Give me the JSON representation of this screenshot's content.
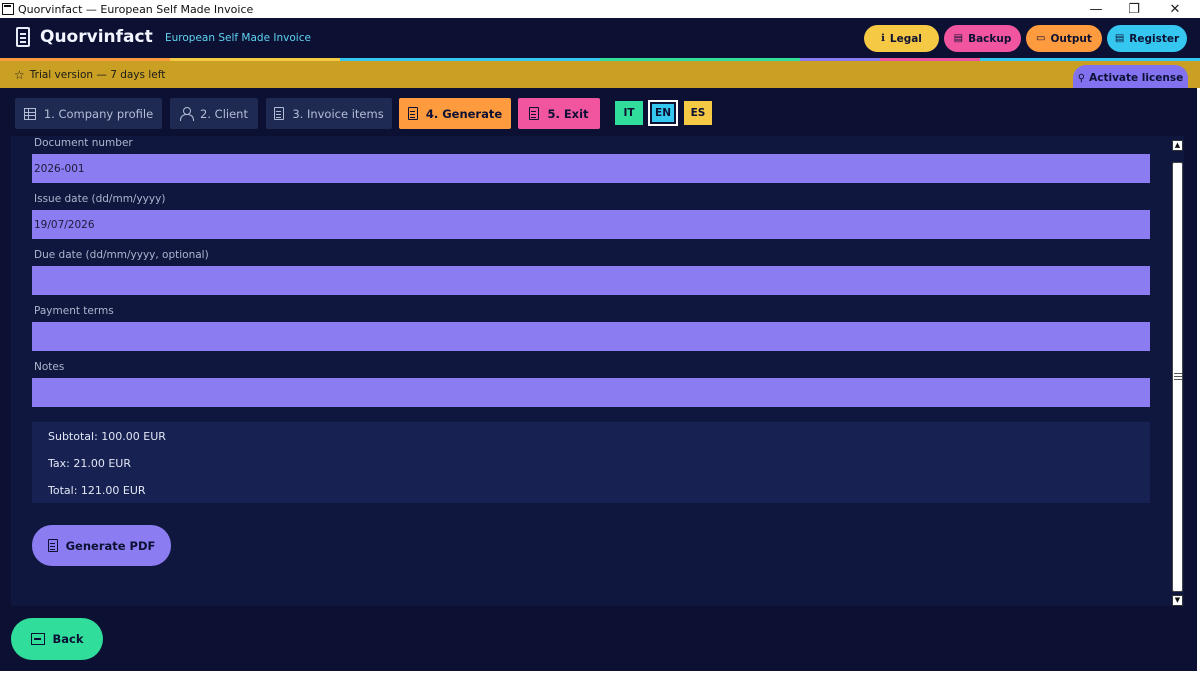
{
  "window": {
    "title": "Quorvinfact — European Self Made Invoice",
    "minimize": "—",
    "restore": "❐",
    "close": "✕"
  },
  "header": {
    "app_name": "Quorvinfact",
    "subtitle": "European Self Made Invoice",
    "buttons": {
      "legal": {
        "icon": "info-icon",
        "glyph": "ℹ",
        "label": "Legal",
        "color": "#f6c945"
      },
      "backup": {
        "icon": "save-icon",
        "glyph": "▤",
        "label": "Backup",
        "color": "#f2559f"
      },
      "output": {
        "icon": "folder-icon",
        "glyph": "▭",
        "label": "Output",
        "color": "#ff9b3f"
      },
      "register": {
        "icon": "register-icon",
        "glyph": "▤",
        "label": "Register",
        "color": "#35c7ef"
      }
    },
    "stripe_colors": [
      "#ff9b3f",
      "#f6c945",
      "#35c7ef",
      "#31dd9a",
      "#8b7cf1",
      "#f2559f",
      "#35c7ef"
    ]
  },
  "trial": {
    "text": "Trial version — 7 days left",
    "activate_label": "Activate license"
  },
  "tabs": [
    {
      "label": "1. Company profile",
      "icon": "building-icon"
    },
    {
      "label": "2. Client",
      "icon": "person-icon"
    },
    {
      "label": "3. Invoice items",
      "icon": "list-icon"
    },
    {
      "label": "4. Generate",
      "icon": "document-icon",
      "color": "#ff9b3f"
    },
    {
      "label": "5. Exit",
      "icon": "exit-icon",
      "color": "#f2559f"
    }
  ],
  "languages": [
    {
      "code": "IT",
      "color": "#31dd9a"
    },
    {
      "code": "EN",
      "color": "#35c7ef",
      "selected": true
    },
    {
      "code": "ES",
      "color": "#f6c945"
    }
  ],
  "form": {
    "document_number": {
      "label": "Document number",
      "value": "2026-001"
    },
    "issue_date": {
      "label": "Issue date (dd/mm/yyyy)",
      "value": "19/07/2026"
    },
    "due_date": {
      "label": "Due date (dd/mm/yyyy, optional)",
      "value": ""
    },
    "payment_terms": {
      "label": "Payment terms",
      "value": ""
    },
    "notes": {
      "label": "Notes",
      "value": ""
    }
  },
  "totals": {
    "subtotal": "Subtotal: 100.00 EUR",
    "tax": "Tax: 21.00 EUR",
    "total": "Total: 121.00 EUR"
  },
  "actions": {
    "generate_pdf": "Generate PDF",
    "back": "Back"
  },
  "scrollbar": {
    "up_glyph": "▲",
    "down_glyph": "▼"
  }
}
